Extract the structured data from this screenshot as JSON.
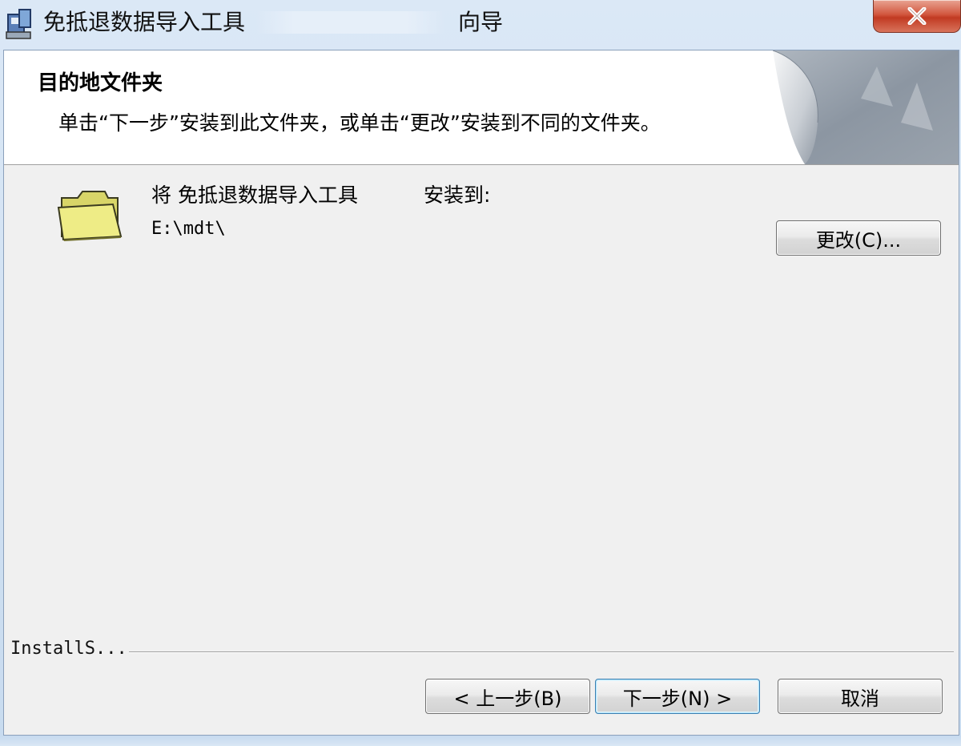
{
  "window": {
    "title": "免抵退数据导入工具",
    "title_suffix": "向导"
  },
  "header": {
    "title": "目的地文件夹",
    "description": "单击“下一步”安装到此文件夹，或单击“更改”安装到不同的文件夹。"
  },
  "body": {
    "install_prefix": "将 免抵退数据导入工具",
    "install_suffix": "安装到:",
    "install_path": "E:\\mdt\\",
    "change_button": "更改(C)..."
  },
  "footer": {
    "brand": "InstallS...",
    "back_button": "< 上一步(B)",
    "next_button": "下一步(N) >",
    "cancel_button": "取消"
  },
  "icons": {
    "app": "installer-icon",
    "folder": "folder-icon",
    "close": "close-icon"
  },
  "colors": {
    "close_button": "#c13a22",
    "folder_fill": "#e8e67a",
    "header_background": "#ffffff",
    "dialog_background": "#f0f0f0"
  }
}
